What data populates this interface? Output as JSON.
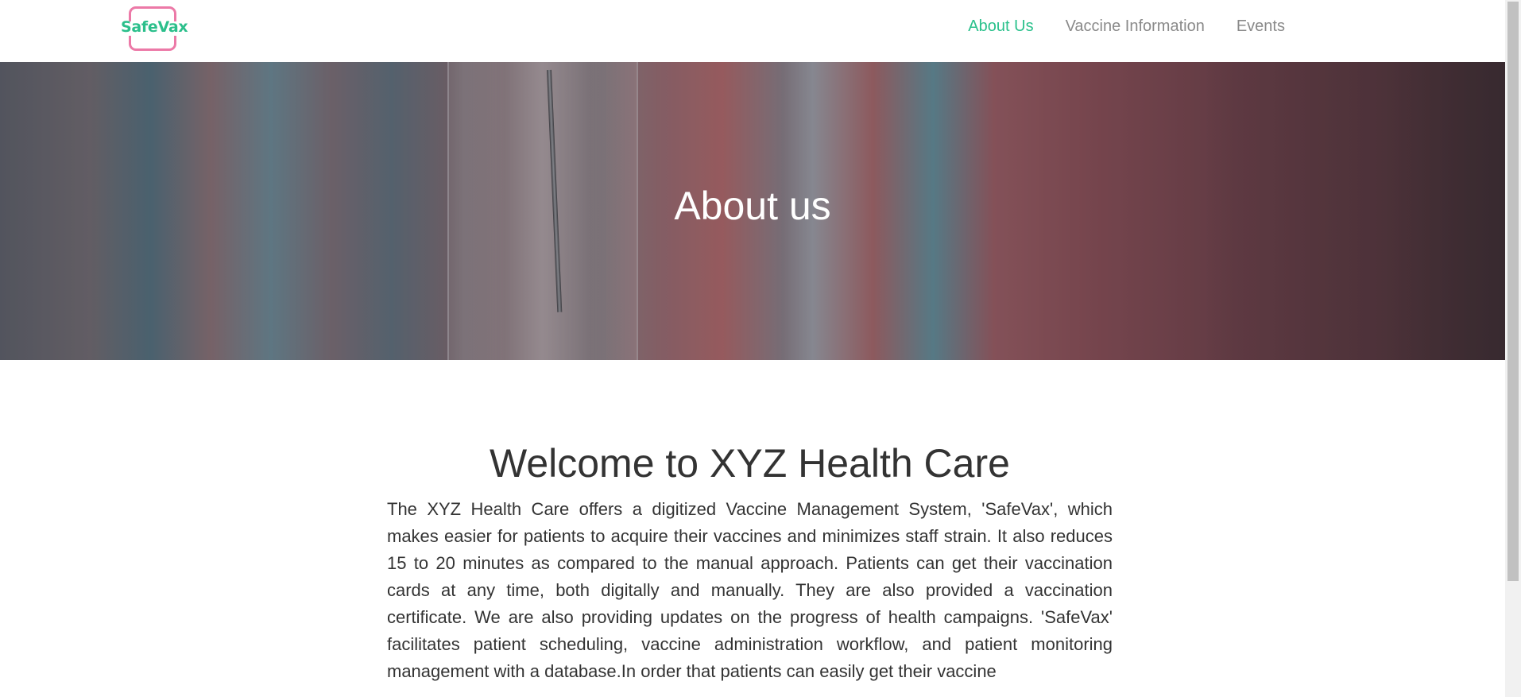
{
  "navbar": {
    "logo_text": "SafeVax",
    "links": [
      {
        "label": "About Us",
        "active": true
      },
      {
        "label": "Vaccine Information",
        "active": false
      },
      {
        "label": "Events",
        "active": false
      }
    ]
  },
  "hero": {
    "title": "About us"
  },
  "main": {
    "heading": "Welcome to XYZ Health Care",
    "paragraph": "The XYZ Health Care offers a digitized Vaccine Management System, 'SafeVax', which makes easier for patients to acquire their vaccines and minimizes staff strain. It also reduces 15 to 20 minutes as compared to the manual approach. Patients can get their vaccination cards at any time, both digitally and manually. They are also provided a vaccination certificate. We are also providing updates on the progress of health campaigns. 'SafeVax' facilitates patient scheduling, vaccine administration workflow, and patient monitoring management with a database.In order that patients can easily get their vaccine"
  },
  "colors": {
    "accent": "#2bc18c",
    "logo_frame": "#ec79a7",
    "nav_inactive": "#8a8a8a"
  }
}
